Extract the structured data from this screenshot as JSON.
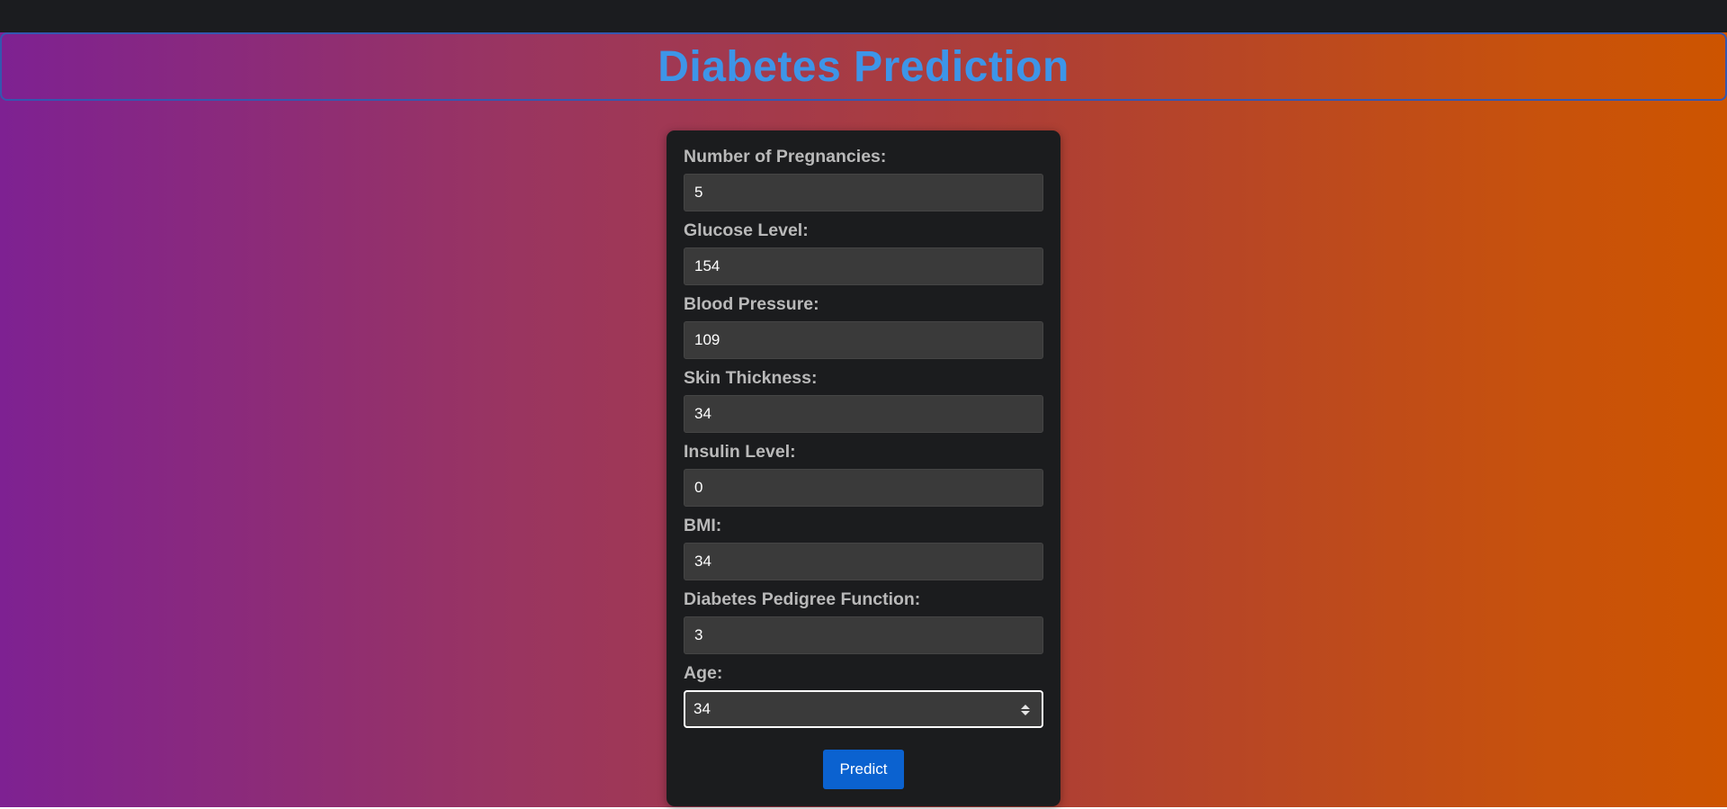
{
  "header": {
    "title": "Diabetes Prediction"
  },
  "form": {
    "fields": [
      {
        "label": "Number of Pregnancies:",
        "value": "5"
      },
      {
        "label": "Glucose Level:",
        "value": "154"
      },
      {
        "label": "Blood Pressure:",
        "value": "109"
      },
      {
        "label": "Skin Thickness:",
        "value": "34"
      },
      {
        "label": "Insulin Level:",
        "value": "0"
      },
      {
        "label": "BMI:",
        "value": "34"
      },
      {
        "label": "Diabetes Pedigree Function:",
        "value": "3"
      },
      {
        "label": "Age:",
        "value": "34"
      }
    ],
    "submit_label": "Predict"
  },
  "colors": {
    "title": "#3d95e8",
    "button": "#0b62d0",
    "card": "#1b1c1e",
    "gradient_start": "#7e2192",
    "gradient_end": "#cd5400"
  },
  "icons": {
    "age_spinner": "spinner-arrows-icon"
  }
}
